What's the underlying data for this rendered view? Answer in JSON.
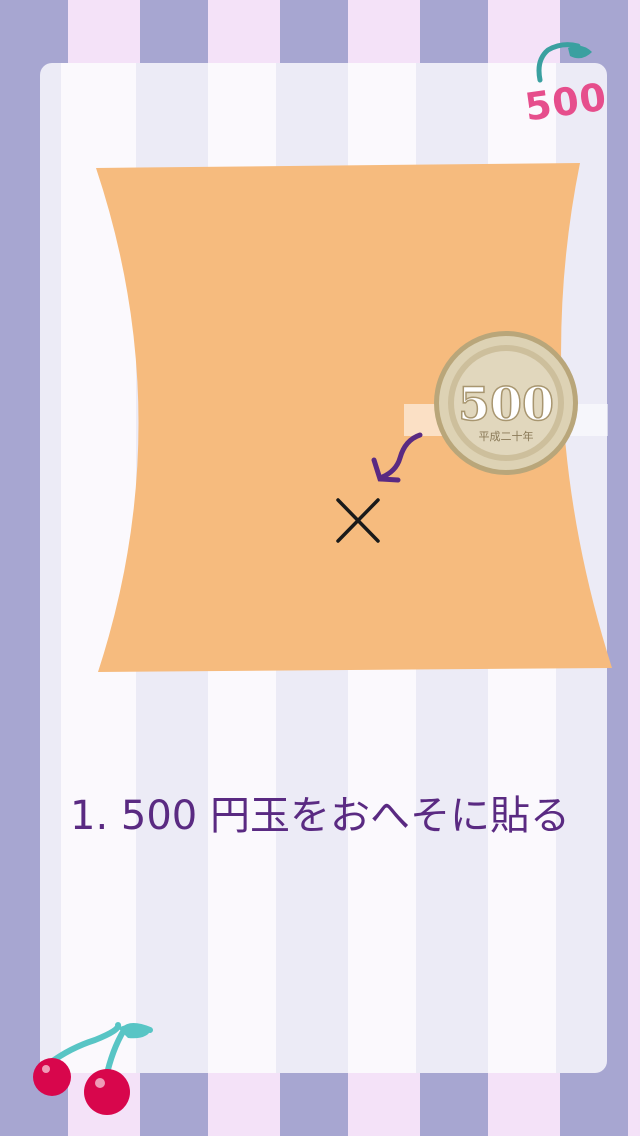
{
  "logo": {
    "text": "500"
  },
  "coin": {
    "value_text": "500",
    "era_text": "平成二十年"
  },
  "instruction": {
    "text": "1. 500 円玉をおへそに貼る"
  },
  "colors": {
    "stripe_dark": "#a7a6d1",
    "stripe_light": "#f4e2f8",
    "belly": "#f6bb7e",
    "text_purple": "#5a2a82",
    "cherry_red": "#d8064c",
    "cherry_stem": "#58c5c5",
    "logo_pink": "#e64e8c"
  }
}
